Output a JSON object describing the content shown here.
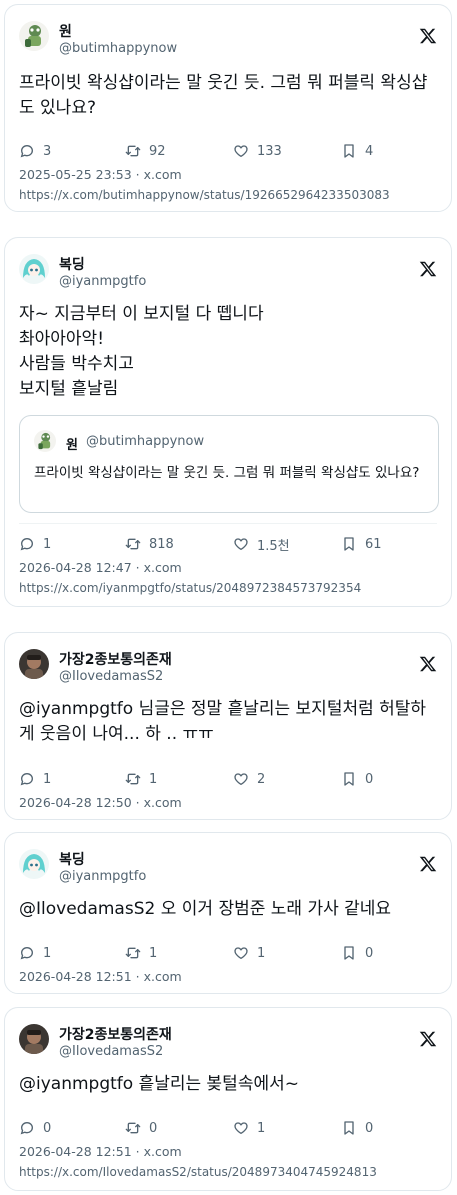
{
  "tweets": [
    {
      "name": "원",
      "handle": "@butimhappynow",
      "text": [
        "프라이빗 왁싱샵이라는 말 웃긴 듯. 그럼 뭐 퍼블릭 왁싱샵",
        "도 있나요?"
      ],
      "replies": "3",
      "retweets": "92",
      "likes": "133",
      "bookmarks": "4",
      "time": "2025-05-25 23:53",
      "source": "x.com",
      "url": "https://x.com/butimhappynow/status/1926652964233503083"
    },
    {
      "name": "복딩",
      "handle": "@iyanmpgtfo",
      "text": [
        "자~ 지금부터 이 보지털 다 뗍니다",
        "촤아아아악!",
        "사람들 박수치고",
        "보지털 흩날림"
      ],
      "quote": {
        "name": "원",
        "handle": "@butimhappynow",
        "text": "프라이빗 왁싱샵이라는 말 웃긴 듯. 그럼 뭐 퍼블릭 왁싱샵도 있나요?"
      },
      "replies": "1",
      "retweets": "818",
      "likes": "1.5천",
      "bookmarks": "61",
      "time": "2026-04-28 12:47",
      "source": "x.com",
      "url": "https://x.com/iyanmpgtfo/status/2048972384573792354"
    },
    {
      "name": "가장2종보통의존재",
      "handle": "@IlovedamasS2",
      "text": [
        "@iyanmpgtfo 님글은 정말 흩날리는 보지털처럼 허탈하",
        "게 웃음이 나여... 하 .. ㅠㅠ"
      ],
      "replies": "1",
      "retweets": "1",
      "likes": "2",
      "bookmarks": "0",
      "time": "2026-04-28 12:50",
      "source": "x.com"
    },
    {
      "name": "복딩",
      "handle": "@iyanmpgtfo",
      "text": [
        "@IlovedamasS2 오 이거 장범준 노래 가사 같네요"
      ],
      "replies": "1",
      "retweets": "1",
      "likes": "1",
      "bookmarks": "0",
      "time": "2026-04-28 12:51",
      "source": "x.com"
    },
    {
      "name": "가장2종보통의존재",
      "handle": "@IlovedamasS2",
      "text": [
        "@iyanmpgtfo 흩날리는 봊털속에서~"
      ],
      "replies": "0",
      "retweets": "0",
      "likes": "1",
      "bookmarks": "0",
      "time": "2026-04-28 12:51",
      "source": "x.com",
      "url": "https://x.com/IlovedamasS2/status/2048973404745924813"
    }
  ]
}
